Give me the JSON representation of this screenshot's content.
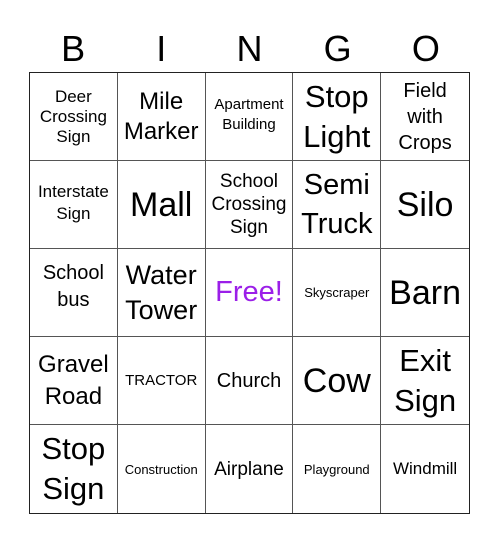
{
  "header": {
    "letters": [
      "B",
      "I",
      "N",
      "G",
      "O"
    ]
  },
  "free_color": "#9B1FE8",
  "board": [
    [
      "Deer Crossing Sign",
      "Mile Marker",
      "Apartment Building",
      "Stop Light",
      "Field with Crops"
    ],
    [
      "Interstate Sign",
      "Mall",
      "School Crossing Sign",
      "Semi Truck",
      "Silo"
    ],
    [
      "School bus",
      "Water Tower",
      "Free!",
      "Skyscraper",
      "Barn"
    ],
    [
      "Gravel Road",
      "TRACTOR",
      "Church",
      "Cow",
      "Exit Sign"
    ],
    [
      "Stop Sign",
      "Construction",
      "Airplane",
      "Playground",
      "Windmill"
    ]
  ]
}
